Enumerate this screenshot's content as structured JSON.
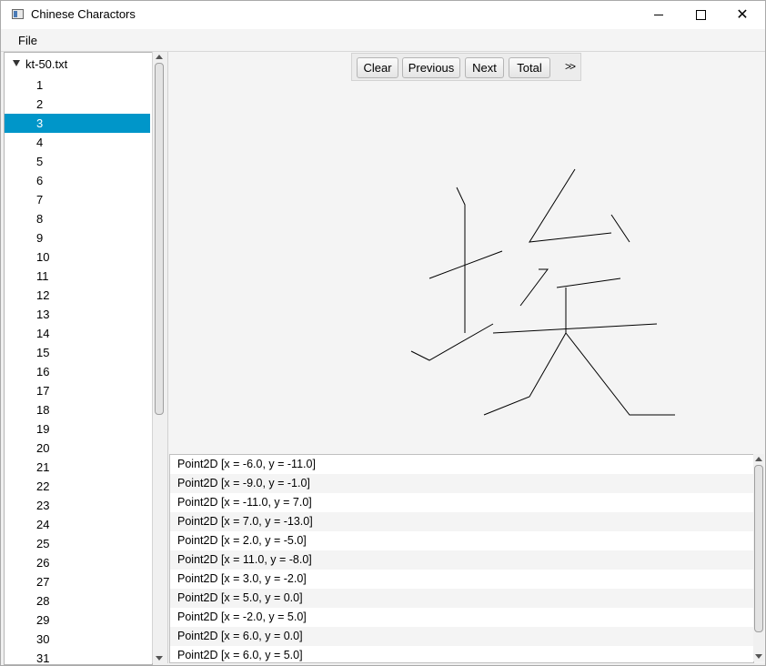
{
  "window": {
    "title": "Chinese Charactors",
    "icon": "app-window-icon",
    "controls": {
      "minimize": "minimize-icon",
      "maximize": "maximize-icon",
      "close": "close-icon",
      "close_glyph": "✕"
    }
  },
  "menu": {
    "file": "File"
  },
  "tree": {
    "root_label": "kt-50.txt",
    "selected": "3",
    "selected_color": "#0096c9",
    "items": [
      "1",
      "2",
      "3",
      "4",
      "5",
      "6",
      "7",
      "8",
      "9",
      "10",
      "11",
      "12",
      "13",
      "14",
      "15",
      "16",
      "17",
      "18",
      "19",
      "20",
      "21",
      "22",
      "23",
      "24",
      "25",
      "26",
      "27",
      "28",
      "29",
      "30",
      "31"
    ]
  },
  "toolbar": {
    "clear": "Clear",
    "previous": "Previous",
    "next": "Next",
    "total": "Total",
    "more": ">>"
  },
  "points": [
    "Point2D [x = -6.0, y = -11.0]",
    "Point2D [x = -9.0, y = -1.0]",
    "Point2D [x = -11.0, y = 7.0]",
    "Point2D [x = 7.0, y = -13.0]",
    "Point2D [x = 2.0, y = -5.0]",
    "Point2D [x = 11.0, y = -8.0]",
    "Point2D [x = 3.0, y = -2.0]",
    "Point2D [x = 5.0, y = 0.0]",
    "Point2D [x = -2.0, y = 5.0]",
    "Point2D [x = 6.0, y = 0.0]",
    "Point2D [x = 6.0, y = 5.0]"
  ]
}
